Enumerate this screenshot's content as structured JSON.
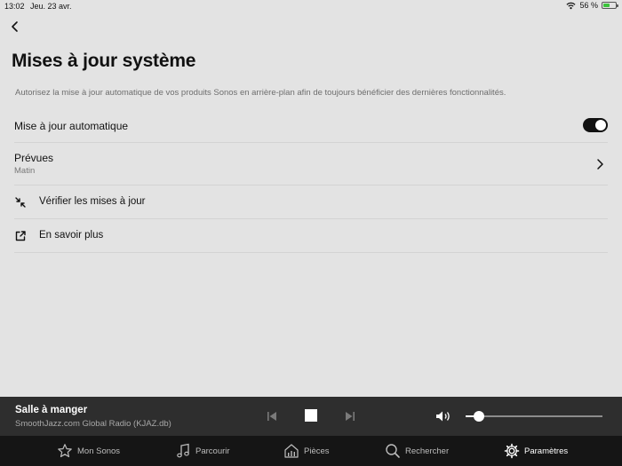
{
  "status": {
    "time": "13:02",
    "date": "Jeu. 23 avr.",
    "battery_text": "56 %",
    "battery_level": 0.56,
    "icons": [
      "wifi-icon",
      "battery-icon"
    ]
  },
  "header": {
    "back_icon": "chevron-left-icon",
    "title": "Mises à jour système",
    "description": "Autorisez la mise à jour automatique de vos produits Sonos en arrière-plan afin de toujours bénéficier des dernières fonctionnalités."
  },
  "settings": {
    "auto_update": {
      "label": "Mise à jour automatique",
      "enabled": true
    },
    "scheduled": {
      "label": "Prévues",
      "value": "Matin",
      "icon": "chevron-right-icon"
    },
    "check_updates": {
      "label": "Vérifier les mises à jour",
      "icon": "collapse-arrows-icon"
    },
    "learn_more": {
      "label": "En savoir plus",
      "icon": "external-link-icon"
    }
  },
  "player": {
    "room": "Salle à manger",
    "track": "SmoothJazz.com Global Radio (KJAZ.db)",
    "volume": 0.1,
    "icons": [
      "previous-icon",
      "stop-icon",
      "next-icon",
      "volume-icon"
    ]
  },
  "tabs": [
    {
      "label": "Mon Sonos",
      "icon": "star-icon",
      "active": false
    },
    {
      "label": "Parcourir",
      "icon": "music-note-icon",
      "active": false
    },
    {
      "label": "Pièces",
      "icon": "house-icon",
      "active": false
    },
    {
      "label": "Rechercher",
      "icon": "search-icon",
      "active": false
    },
    {
      "label": "Paramètres",
      "icon": "gear-icon",
      "active": true
    }
  ],
  "colors": {
    "background": "#e3e3e3",
    "player_bg": "#2e2e2e",
    "tabbar_bg": "#151515",
    "battery": "#3cc43c"
  }
}
